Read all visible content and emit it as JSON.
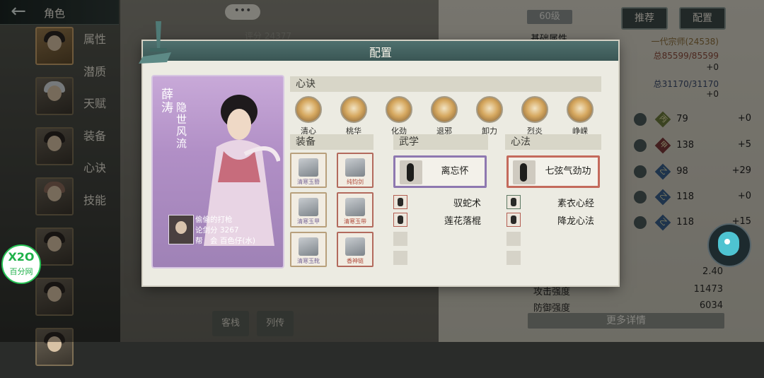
{
  "header": {
    "back_icon": "←",
    "title": "角色",
    "more": "•••",
    "score": "评分 24377"
  },
  "side_menu": [
    "属性",
    "潜质",
    "天赋",
    "装备",
    "心诀",
    "技能"
  ],
  "top_right": {
    "level": "60级",
    "recommend_label": "推荐",
    "config_label": "配置",
    "basic_attr_label": "基础属性",
    "title_line": "一代宗师(24538)",
    "hp_line": "总85599/85599",
    "hp_bonus": "+0",
    "mp_line": "总31170/31170",
    "mp_bonus": "+0"
  },
  "stats": [
    {
      "badge": "丙",
      "badge_color": "#6c7a3c",
      "value": "79",
      "bonus": "+0"
    },
    {
      "badge": "甲",
      "badge_color": "#7a3a3a",
      "value": "138",
      "bonus": "+5"
    },
    {
      "badge": "乙",
      "badge_color": "#3a5f8a",
      "value": "98",
      "bonus": "+29"
    },
    {
      "badge": "乙",
      "badge_color": "#3a5f8a",
      "value": "118",
      "bonus": "+0"
    },
    {
      "badge": "乙",
      "badge_color": "#3a5f8a",
      "value": "118",
      "bonus": "+15"
    }
  ],
  "bottom_stats": [
    {
      "label": "",
      "value": "2.40"
    },
    {
      "label": "攻击强度",
      "value": "11473"
    },
    {
      "label": "防御强度",
      "value": "6034"
    }
  ],
  "more_detail_label": "更多详情",
  "bottom_tabs": [
    "客栈",
    "列传"
  ],
  "watermark": {
    "line1": "X2O",
    "line2": "百分网"
  },
  "modal": {
    "title": "配置",
    "character": {
      "name": "薛涛",
      "title": "隐世风流",
      "player_line1": "偷偷的打枪",
      "player_line2": "论剑分 3267",
      "player_line3": "帮　会 百色仔(水)"
    },
    "xinjue_label": "心诀",
    "xinjue": [
      "清心",
      "桃华",
      "化劲",
      "退邪",
      "卸力",
      "烈炎",
      "峥嵘"
    ],
    "equip_label": "装备",
    "equipment": [
      {
        "name": "清寒玉簪",
        "tier": "blue"
      },
      {
        "name": "纯钧剑",
        "tier": "red"
      },
      {
        "name": "清寒玉甲",
        "tier": "blue"
      },
      {
        "name": "清寒玉带",
        "tier": "red"
      },
      {
        "name": "清寒玉靴",
        "tier": "blue"
      },
      {
        "name": "香神链",
        "tier": "red"
      }
    ],
    "wuxue_label": "武学",
    "wuxue_main": "离忘怀",
    "wuxue_subs": [
      "驭蛇术",
      "莲花落棍"
    ],
    "xinfa_label": "心法",
    "xinfa_main": "七弦气劲功",
    "xinfa_subs": [
      "素衣心经",
      "降龙心法"
    ]
  }
}
